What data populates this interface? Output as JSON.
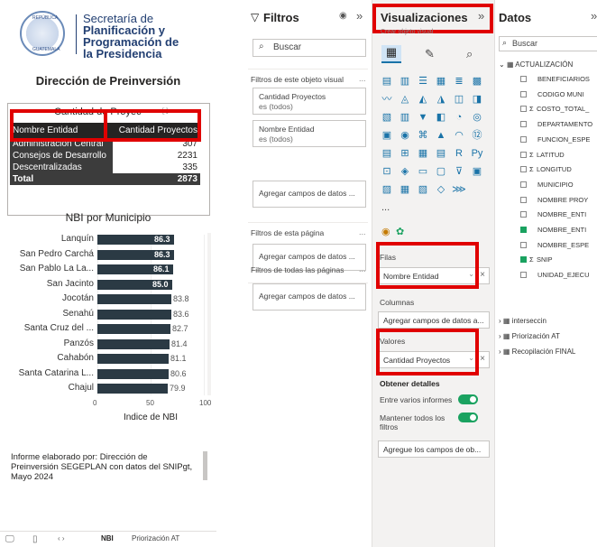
{
  "report": {
    "logo": {
      "line1": "Secretaría de",
      "line2": "Planificación y",
      "line3": "Programación de",
      "line4": "la Presidencia",
      "seal_top": "REPÚBLICA",
      "seal_bottom": "GUATEMALA"
    },
    "page_title": "Dirección de Preinversión",
    "table": {
      "title": "Cantidad de Proyec",
      "headers": [
        "Nombre Entidad",
        "Cantidad Proyectos"
      ],
      "rows": [
        {
          "name": "Administración Central",
          "value": "307"
        },
        {
          "name": "Consejos de Desarrollo",
          "value": "2231"
        },
        {
          "name": "Descentralizadas",
          "value": "335"
        }
      ],
      "total_label": "Total",
      "total_value": "2873"
    },
    "chart_title": "NBI por Municipio",
    "note": "Informe elaborado por: Dirección de Preinversión  SEGEPLAN con datos del SNIPgt, Mayo 2024",
    "footer": {
      "tab_nbi": "NBI",
      "tab_priorizacion": "Priorización AT"
    }
  },
  "chart_data": {
    "type": "bar",
    "orientation": "horizontal",
    "title": "NBI por Municipio",
    "xlabel": "Indice de NBI",
    "ylabel": "",
    "categories": [
      "Lanquín",
      "San Pedro Carchá",
      "San Pablo La La...",
      "San Jacinto",
      "Jocotán",
      "Senahú",
      "Santa Cruz del ...",
      "Panzós",
      "Cahabón",
      "Santa Catarina L...",
      "Chajul"
    ],
    "values": [
      86.3,
      86.3,
      86.1,
      85.0,
      83.8,
      83.6,
      82.7,
      81.4,
      81.1,
      80.6,
      79.9
    ],
    "labels": [
      "86.3",
      "86.3",
      "86.1",
      "85.0",
      "83.8",
      "83.6",
      "82.7",
      "81.4",
      "81.1",
      "80.6",
      "79.9"
    ],
    "xlim": [
      0,
      100
    ],
    "xticks": [
      "0",
      "50",
      "100"
    ],
    "color": "#2b3a44"
  },
  "filters_pane": {
    "title": "Filtros",
    "search_placeholder": "Buscar",
    "visual_section": "Filtros de este objeto visual",
    "cards": [
      {
        "field": "Cantidad Proyectos",
        "sub": "es (todos)"
      },
      {
        "field": "Nombre Entidad",
        "sub": "es (todos)"
      }
    ],
    "add_fields": "Agregar campos de datos ...",
    "page_section": "Filtros de esta página",
    "all_pages_section": "Filtros de todas las páginas",
    "more": "..."
  },
  "viz_pane": {
    "title": "Visualizaciones",
    "sub": "Crear objeto visual",
    "rows_label": "Filas",
    "rows_value": "Nombre Entidad",
    "cols_label": "Columnas",
    "cols_placeholder": "Agregar campos de datos a...",
    "values_label": "Valores",
    "values_value": "Cantidad Proyectos",
    "details_label": "Obtener detalles",
    "cross_report": "Entre varios informes",
    "keep_filters": "Mantener todos los filtros",
    "add_fields": "Agregue los campos de ob...",
    "more": "..."
  },
  "data_pane": {
    "title": "Datos",
    "search_placeholder": "Buscar",
    "table_name": "ACTUALIZACIÓN",
    "fields": [
      {
        "name": "BENEFICIARIOS",
        "sigma": false,
        "checked": false
      },
      {
        "name": "CODIGO MUNI",
        "sigma": false,
        "checked": false
      },
      {
        "name": "COSTO_TOTAL_",
        "sigma": true,
        "checked": false
      },
      {
        "name": "DEPARTAMENTO",
        "sigma": false,
        "checked": false
      },
      {
        "name": "FUNCION_ESPE",
        "sigma": false,
        "checked": false
      },
      {
        "name": "LATITUD",
        "sigma": true,
        "checked": false
      },
      {
        "name": "LONGITUD",
        "sigma": true,
        "checked": false
      },
      {
        "name": "MUNICIPIO",
        "sigma": false,
        "checked": false
      },
      {
        "name": "NOMBRE PROY",
        "sigma": false,
        "checked": false
      },
      {
        "name": "NOMBRE_ENTI",
        "sigma": false,
        "checked": false
      },
      {
        "name": "NOMBRE_ENTI",
        "sigma": false,
        "checked": true
      },
      {
        "name": "NOMBRE_ESPE",
        "sigma": false,
        "checked": false
      },
      {
        "name": "SNIP",
        "sigma": true,
        "checked": true
      },
      {
        "name": "UNIDAD_EJECU",
        "sigma": false,
        "checked": false
      }
    ],
    "tables": [
      "interseccin",
      "Priorización AT",
      "Recopilación FINAL"
    ]
  },
  "colors": {
    "highlight_box": "#e00000",
    "bar": "#2b3a44",
    "toggle_on": "#1aa260"
  }
}
